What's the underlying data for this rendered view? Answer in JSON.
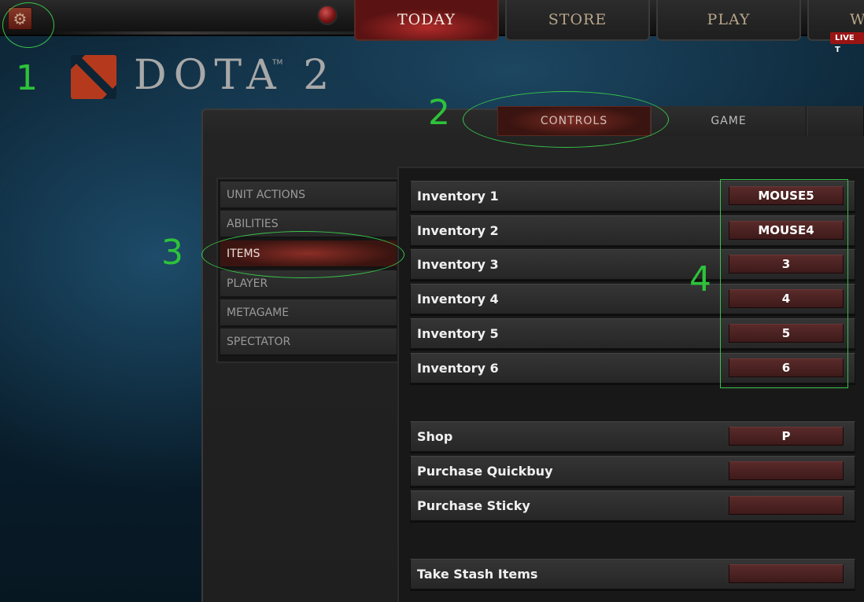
{
  "topnav": {
    "tabs": [
      {
        "label": "TODAY",
        "active": true
      },
      {
        "label": "STORE",
        "active": false
      },
      {
        "label": "PLAY",
        "active": false
      },
      {
        "label": "W",
        "active": false
      }
    ],
    "live_badge": "LIVE T"
  },
  "logo": {
    "text": "DOTA 2",
    "tm": "TM"
  },
  "settings_tabs": [
    {
      "label": "CONTROLS",
      "active": true
    },
    {
      "label": "GAME",
      "active": false
    }
  ],
  "categories": [
    {
      "label": "UNIT ACTIONS",
      "active": false
    },
    {
      "label": "ABILITIES",
      "active": false
    },
    {
      "label": "ITEMS",
      "active": true
    },
    {
      "label": "PLAYER",
      "active": false
    },
    {
      "label": "METAGAME",
      "active": false
    },
    {
      "label": "SPECTATOR",
      "active": false
    }
  ],
  "bindings": [
    {
      "label": "Inventory 1",
      "key": "MOUSE5"
    },
    {
      "label": "Inventory 2",
      "key": "MOUSE4"
    },
    {
      "label": "Inventory 3",
      "key": "3"
    },
    {
      "label": "Inventory 4",
      "key": "4"
    },
    {
      "label": "Inventory 5",
      "key": "5"
    },
    {
      "label": "Inventory 6",
      "key": "6"
    },
    {
      "label": "Shop",
      "key": "P"
    },
    {
      "label": "Purchase Quickbuy",
      "key": ""
    },
    {
      "label": "Purchase Sticky",
      "key": ""
    },
    {
      "label": "Take Stash Items",
      "key": ""
    }
  ],
  "annotations": {
    "n1": "1",
    "n2": "2",
    "n3": "3",
    "n4": "4",
    "color": "#2ec23a"
  },
  "colors": {
    "accent_red": "#8a2e26",
    "key_bg": "#5a2a2a",
    "background_blue": "#0f2a3c"
  },
  "icons": {
    "settings": "gear-icon",
    "logo": "dota-logo-icon"
  }
}
